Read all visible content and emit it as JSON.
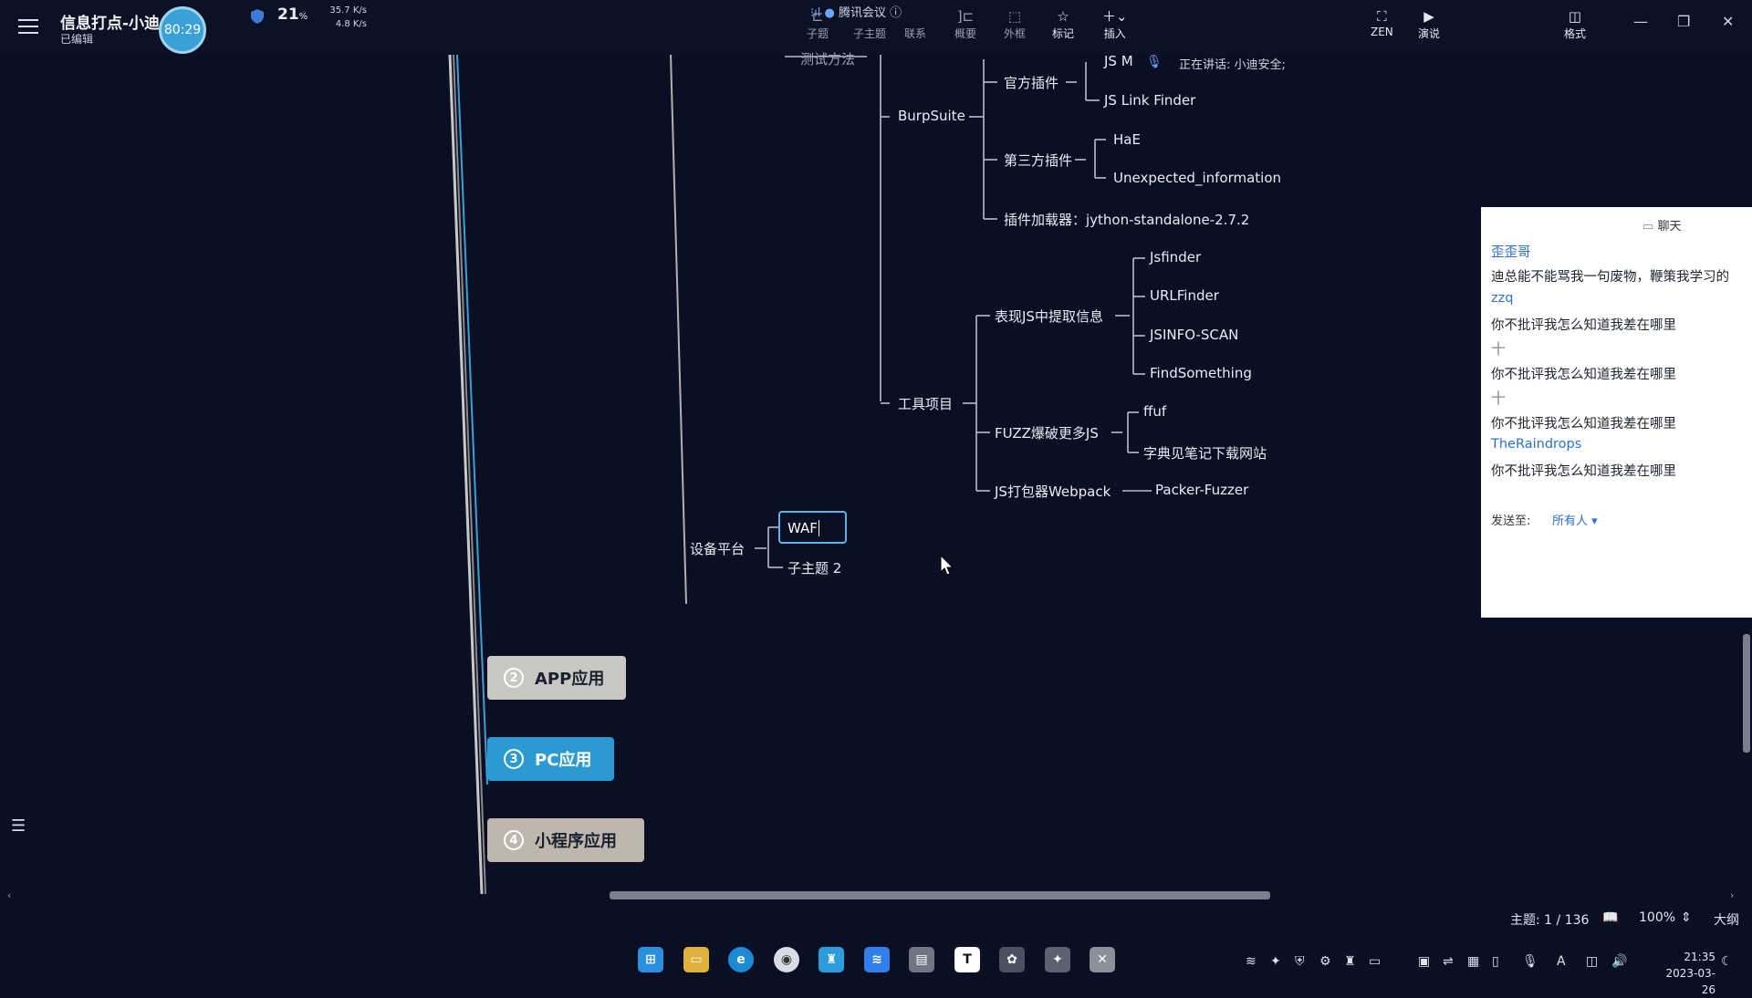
{
  "window": {
    "title": "信息打点-小迪",
    "status": "已编辑",
    "timer": "80:29"
  },
  "sysmon": {
    "cpu_percent": "21",
    "cpu_unit": "%",
    "net_up": "35.7 K/s",
    "net_down": "4.8 K/s"
  },
  "meeting": {
    "label": "腾讯会议"
  },
  "toolbar": {
    "subtopic": "子题",
    "child": "子主题",
    "link": "联系",
    "summary": "概要",
    "outline_box": "外框",
    "mark": "标记",
    "insert": "插入",
    "zen": "ZEN",
    "present": "演说",
    "format": "格式"
  },
  "mindmap": {
    "test_method": "测试方法",
    "burpsuite": "BurpSuite",
    "official_plugins": "官方插件",
    "js_m": "JS M",
    "speaking": "正在讲话: 小迪安全;",
    "js_link_finder": "JS Link Finder",
    "third_party_plugins": "第三方插件",
    "hae": "HaE",
    "unexpected_information": "Unexpected_information",
    "plugin_loader": "插件加载器：jython-standalone-2.7.2",
    "extract_js_info": "表现JS中提取信息",
    "jsfinder": "Jsfinder",
    "urlfinder": "URLFinder",
    "jsinfo_scan": "JSINFO-SCAN",
    "findsomething": "FindSomething",
    "tool_projects": "工具项目",
    "fuzz_more_js": "FUZZ爆破更多JS",
    "ffuf": "ffuf",
    "dict_note": "字典见笔记下载网站",
    "js_packer": "JS打包器Webpack",
    "packer_fuzzer": "Packer-Fuzzer",
    "device_platform": "设备平台",
    "waf": "WAF",
    "subtopic2": "子主题 2",
    "topics": [
      {
        "num": "2",
        "label": "APP应用"
      },
      {
        "num": "3",
        "label": "PC应用"
      },
      {
        "num": "4",
        "label": "小程序应用"
      }
    ]
  },
  "chat": {
    "title": "聊天",
    "messages": [
      {
        "type": "name",
        "text": "歪歪哥"
      },
      {
        "type": "text",
        "text": "迪总能不能骂我一句废物，鞭策我学习的"
      },
      {
        "type": "name",
        "text": "zzq"
      },
      {
        "type": "text",
        "text": "你不批评我怎么知道我差在哪里"
      },
      {
        "type": "plus",
        "text": "十"
      },
      {
        "type": "text",
        "text": "你不批评我怎么知道我差在哪里"
      },
      {
        "type": "plus",
        "text": "十"
      },
      {
        "type": "text",
        "text": "你不批评我怎么知道我差在哪里"
      },
      {
        "type": "name",
        "text": "TheRaindrops"
      },
      {
        "type": "text",
        "text": "你不批评我怎么知道我差在哪里"
      }
    ],
    "send_to_label": "发送至:",
    "send_to_value": "所有人"
  },
  "statusbar": {
    "topic_count": "主题: 1 / 136",
    "zoom": "100%",
    "outline": "大纲"
  },
  "taskbar": {
    "time": "21:35",
    "date": "2023-03-26",
    "typora_letter": "T",
    "ime": "A"
  },
  "colors": {
    "background": "#0b0f24",
    "accent": "#3aa0d6",
    "topic_app": "#c9c7c2",
    "topic_pc": "#2a9ad0",
    "topic_mini": "#bfb7ad"
  }
}
